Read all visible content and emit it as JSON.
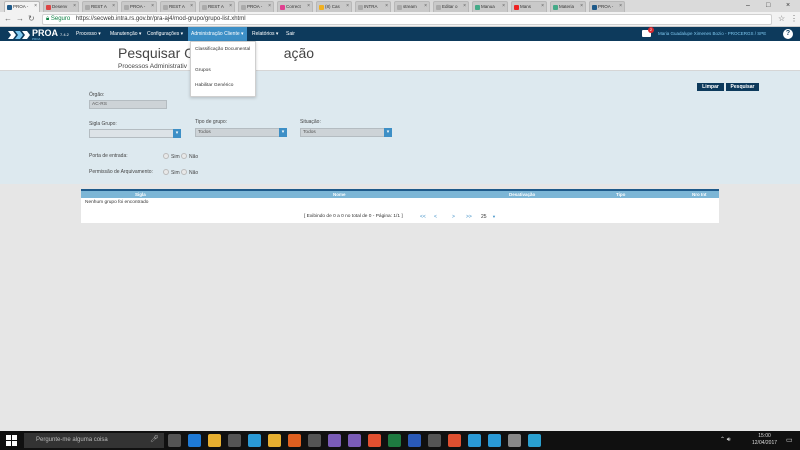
{
  "browser": {
    "tabs": [
      {
        "label": "PROA -",
        "color": "#1e5a8a",
        "active": true
      },
      {
        "label": "Desenv",
        "color": "#d44"
      },
      {
        "label": "REST A",
        "color": "#aaa"
      },
      {
        "label": "PROA -",
        "color": "#aaa"
      },
      {
        "label": "REST A",
        "color": "#aaa"
      },
      {
        "label": "REST A",
        "color": "#aaa"
      },
      {
        "label": "PROA -",
        "color": "#aaa"
      },
      {
        "label": "Correct",
        "color": "#e04090"
      },
      {
        "label": "(8) Cas",
        "color": "#f0b020"
      },
      {
        "label": "INTRA",
        "color": "#aaa"
      },
      {
        "label": "stream",
        "color": "#aaa"
      },
      {
        "label": "Editar o",
        "color": "#aaa"
      },
      {
        "label": "Manua",
        "color": "#4a8"
      },
      {
        "label": "Mans",
        "color": "#e22"
      },
      {
        "label": "Materia",
        "color": "#4a8"
      },
      {
        "label": "PROA -",
        "color": "#1e5a8a"
      }
    ],
    "security_label": "Seguro",
    "url": "https://secweb.intra.rs.gov.br/pra-aj4/mod-grupo/grupo-list.xhtml"
  },
  "app": {
    "logo_text": "PROA",
    "logo_version": "7.4.2",
    "logo_sub": "PROA",
    "menu": [
      {
        "label": "Processo",
        "has_caret": true
      },
      {
        "label": "Manutenção",
        "has_caret": true
      },
      {
        "label": "Configurações",
        "has_caret": true
      },
      {
        "label": "Administração Cliente",
        "has_caret": true,
        "active": true
      },
      {
        "label": "Relatórios",
        "has_caret": true
      },
      {
        "label": "Sair",
        "has_caret": false
      }
    ],
    "mail_count": "2",
    "user": "Maria Guadalupe Ximenes Bozio - PROCERGS / SPE",
    "help_icon": "?"
  },
  "page": {
    "title_visible": "Pesquisar Gr",
    "title_suffix": "ação",
    "subtitle_visible": "Processos Administrativ"
  },
  "dropdown": {
    "items": [
      "Classificação Documental",
      "Grupos",
      "Habilitar Genérico"
    ]
  },
  "form": {
    "buttons": {
      "clear": "Limpar",
      "search": "Pesquisar"
    },
    "orgao_label": "Órgão:",
    "orgao_value": "AC-RS",
    "sigla_label": "Sigla Grupo:",
    "sigla_value": "",
    "tipo_label": "Tipo de grupo:",
    "tipo_value": "Todos",
    "situacao_label": "Situação:",
    "situacao_value": "Todos",
    "porta_label": "Porta de entrada:",
    "permissao_label": "Permissão de Arquivamento:",
    "yes": "Sim",
    "no": "Não"
  },
  "table": {
    "columns": [
      "Sigla",
      "Nome",
      "Desativação",
      "Tipo",
      "Nro Int"
    ],
    "empty_message": "Nenhum grupo foi encontrado",
    "pager_info": "[ Exibindo de 0 a 0 no total de 0 - Página: 1/1 ]",
    "pager_links": [
      "<<",
      "<",
      ">",
      ">>"
    ],
    "page_size": "25"
  },
  "taskbar": {
    "search_placeholder": "Pergunte-me alguma coisa",
    "time": "15:00",
    "date": "12/04/2017",
    "apps": [
      {
        "name": "task-view-icon",
        "color": "#555"
      },
      {
        "name": "edge-icon",
        "color": "#1e7ad6"
      },
      {
        "name": "file-explorer-icon",
        "color": "#e8b030"
      },
      {
        "name": "store-icon",
        "color": "#555"
      },
      {
        "name": "ie-icon",
        "color": "#2a9ad6"
      },
      {
        "name": "chrome-icon",
        "color": "#e8b030"
      },
      {
        "name": "firefox-icon",
        "color": "#e06020"
      },
      {
        "name": "calculator-icon",
        "color": "#555"
      },
      {
        "name": "eclipse-icon",
        "color": "#7a5cb8"
      },
      {
        "name": "visual-studio-icon",
        "color": "#7a5cb8"
      },
      {
        "name": "git-icon",
        "color": "#e25030"
      },
      {
        "name": "excel-icon",
        "color": "#1e7a40"
      },
      {
        "name": "word-icon",
        "color": "#2a5ab8"
      },
      {
        "name": "people-icon",
        "color": "#555"
      },
      {
        "name": "app-icon-1",
        "color": "#e05030"
      },
      {
        "name": "app-icon-2",
        "color": "#2a9ad6"
      },
      {
        "name": "app-icon-3",
        "color": "#2a9ad6"
      },
      {
        "name": "app-icon-4",
        "color": "#888"
      },
      {
        "name": "app-icon-5",
        "color": "#2aa0d0"
      }
    ]
  }
}
